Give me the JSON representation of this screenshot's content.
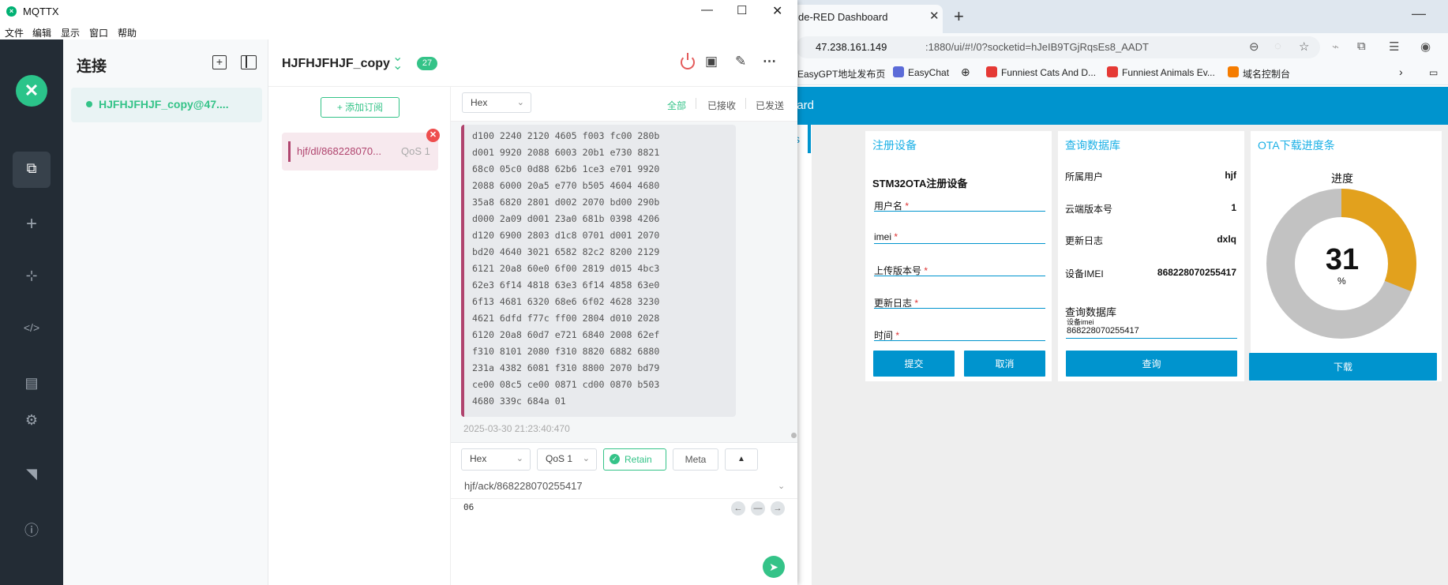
{
  "browser": {
    "tab_title": "de-RED Dashboard",
    "url_host": "47.238.161.149",
    "url_rest": ":1880/ui/#!/0?socketid=hJeIB9TGjRqsEs8_AADT",
    "bookmarks": [
      {
        "label": "EasyGPT地址发布页",
        "color": "#4a90d9"
      },
      {
        "label": "EasyChat",
        "color": "#5b6bd8"
      },
      {
        "label": "",
        "color": "#555555"
      },
      {
        "label": "Funniest Cats And D...",
        "color": "#e53935"
      },
      {
        "label": "Funniest Animals Ev...",
        "color": "#e53935"
      },
      {
        "label": "域名控制台",
        "color": "#f57c00"
      }
    ]
  },
  "dashboard": {
    "header_title": "oard",
    "nav_stub": "s",
    "register": {
      "group_title": "注册设备",
      "form_title": "STM32OTA注册设备",
      "fields": [
        "用户名",
        "imei",
        "上传版本号",
        "更新日志",
        "时间"
      ],
      "submit_label": "提交",
      "cancel_label": "取消"
    },
    "query": {
      "group_title": "查询数据库",
      "rows": [
        {
          "key": "所属用户",
          "value": "hjf"
        },
        {
          "key": "云端版本号",
          "value": "1"
        },
        {
          "key": "更新日志",
          "value": "dxlq"
        },
        {
          "key": "设备IMEI",
          "value": "868228070255417"
        }
      ],
      "input_title": "查询数据库",
      "input_label": "设备imei",
      "input_value": "868228070255417",
      "query_label": "查询"
    },
    "ota": {
      "group_title": "OTA下载进度条",
      "gauge_label": "进度",
      "progress_value": 31,
      "progress_text": "31",
      "unit": "%",
      "fill_color": "#e2a11d",
      "track_color": "#c2c2c2",
      "download_label": "下载"
    }
  },
  "mqttx": {
    "app_title": "MQTTX",
    "menu": [
      "文件",
      "编辑",
      "显示",
      "窗口",
      "帮助"
    ],
    "connections_title": "连接",
    "connection_name": "HJFHJFHJF_copy@47....",
    "main_title": "HJFHJFHJF_copy",
    "message_count": "27",
    "add_subscription_label": "添加订阅",
    "subscription": {
      "topic": "hjf/dl/868228070...",
      "qos": "QoS 1",
      "color": "#b0446e"
    },
    "payload_format": "Hex",
    "filters": {
      "all": "全部",
      "received": "已接收",
      "sent": "已发送"
    },
    "message_hex": [
      "d100 2240 2120 4605 f003 fc00 280b",
      "d001 9920 2088 6003 20b1 e730 8821",
      "68c0 05c0 0d88 62b6 1ce3 e701 9920",
      "2088 6000 20a5 e770 b505 4604 4680",
      "35a8 6820 2801 d002 2070 bd00 290b",
      "d000 2a09 d001 23a0 681b 0398 4206",
      "d120 6900 2803 d1c8 0701 d001 2070",
      "bd20 4640 3021 6582 82c2 8200 2129",
      "6121 20a8 60e0 6f00 2819 d015 4bc3",
      "62e3 6f14 4818 63e3 6f14 4858 63e0",
      "6f13 4681 6320 68e6 6f02 4628 3230",
      "4621 6dfd f77c ff00 2804 d010 2028",
      "6120 20a8 60d7 e721 6840 2008 62ef",
      "f310 8101 2080 f310 8820 6882 6880",
      "231a 4382 6081 f310 8800 2070 bd79",
      "ce00 08c5 ce00 0871 cd00 0870 b503",
      "4680 339c 684a 01"
    ],
    "message_time": "2025-03-30 21:23:40:470",
    "publish": {
      "format": "Hex",
      "qos": "QoS 1",
      "retain_label": "Retain",
      "meta_label": "Meta",
      "topic": "hjf/ack/868228070255417",
      "payload": "06"
    }
  }
}
